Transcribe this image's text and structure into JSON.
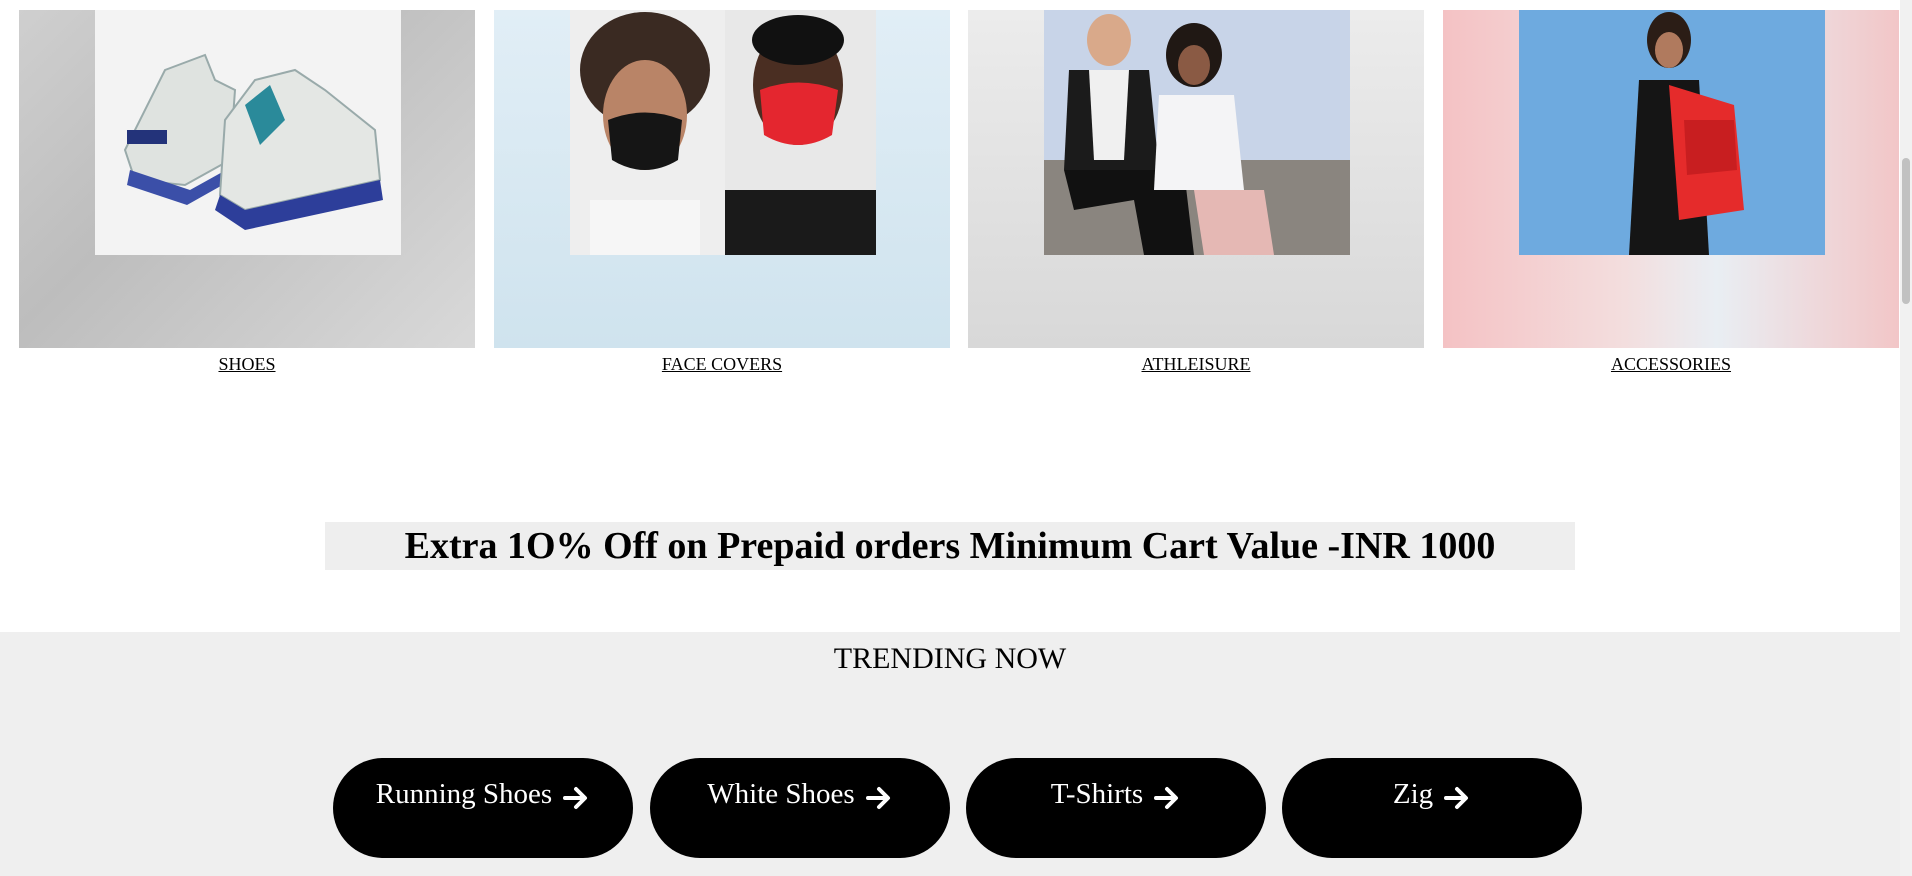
{
  "categories": [
    {
      "label": "SHOES"
    },
    {
      "label": "FACE COVERS"
    },
    {
      "label": "ATHLEISURE"
    },
    {
      "label": "ACCESSORIES"
    }
  ],
  "promo": {
    "text": "Extra 1O% Off on Prepaid orders Minimum Cart Value -INR 1000"
  },
  "trending": {
    "title": "TRENDING NOW",
    "buttons": [
      {
        "label": "Running Shoes",
        "icon": "arrow-right-icon"
      },
      {
        "label": "White Shoes",
        "icon": "arrow-right-icon"
      },
      {
        "label": "T-Shirts",
        "icon": "arrow-right-icon"
      },
      {
        "label": "Zig",
        "icon": "arrow-right-icon"
      }
    ]
  },
  "colors": {
    "button_bg": "#000000",
    "button_text": "#ffffff",
    "section_bg": "#efefef",
    "promo_bg": "#eeeeee"
  }
}
